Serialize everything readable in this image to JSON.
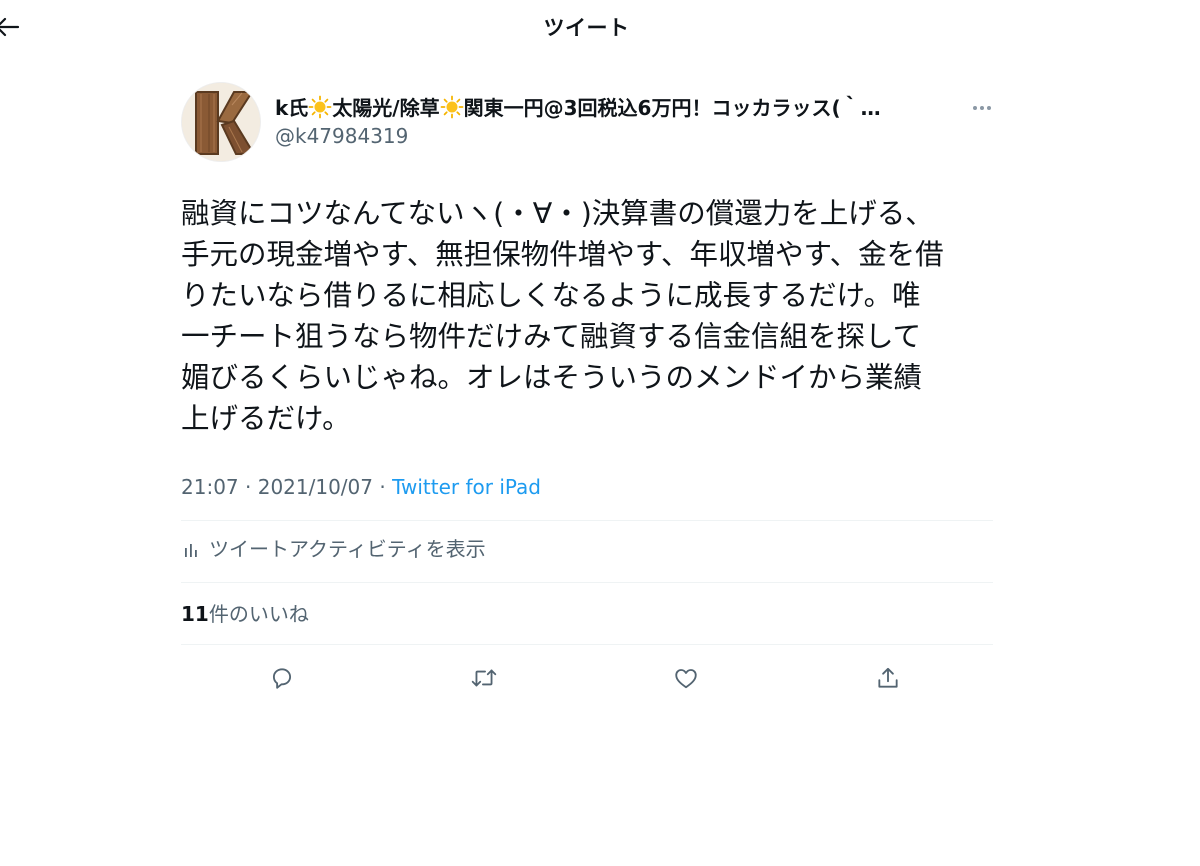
{
  "header": {
    "title": "ツイート",
    "back_icon": "arrow-left-icon"
  },
  "tweet": {
    "author": {
      "name_part1": "k氏",
      "name_part2": "太陽光/除草",
      "name_part3": "関東一円@3回税込6万円！コッカラッス(｀…",
      "emoji": "☀",
      "handle": "@k47984319",
      "avatar_icon": "wooden-letter-k-avatar"
    },
    "more_icon": "more-horizontal-icon",
    "text": "融資にコツなんてないヽ(・∀・)決算書の償還力を上げる、\n手元の現金増やす、無担保物件増やす、年収増やす、金を借\nりたいなら借りるに相応しくなるように成長するだけ。唯\n一チート狙うなら物件だけみて融資する信金信組を探して\n媚びるくらいじゃね。オレはそういうのメンドイから業績\n上げるだけ。",
    "time": "21:07",
    "separator": " · ",
    "date": "2021/10/07",
    "source": "Twitter for iPad",
    "activity_label": "ツイートアクティビティを表示",
    "likes_count": "11",
    "likes_label": "件のいいね",
    "actions": {
      "reply_icon": "reply-icon",
      "retweet_icon": "retweet-icon",
      "like_icon": "heart-icon",
      "share_icon": "share-icon"
    }
  },
  "colors": {
    "text": "#0f1419",
    "secondary": "#536471",
    "accent": "#1d9bf0",
    "divider": "#eff3f4",
    "sun": "#f5b400"
  }
}
